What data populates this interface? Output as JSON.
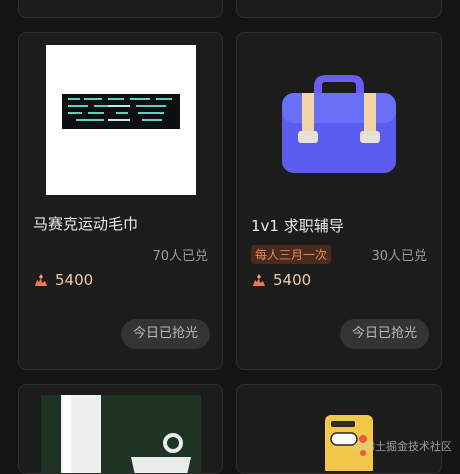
{
  "products": [
    {
      "title": "马赛克运动毛巾",
      "redeemed": "70人已兑",
      "tag": "",
      "price": "5400",
      "button": "今日已抢光"
    },
    {
      "title": "1v1 求职辅导",
      "redeemed": "30人已兑",
      "tag": "每人三月一次",
      "price": "5400",
      "button": "今日已抢光"
    }
  ],
  "icons": {
    "coin": "ore-coin-icon",
    "briefcase": "briefcase-icon"
  },
  "watermark": "@稀土掘金技术社区",
  "colors": {
    "background": "#141414",
    "card": "#1c1c1c",
    "price": "#f0c9a8",
    "tag": "#e88a5a",
    "briefcase": "#5b5cf0"
  }
}
